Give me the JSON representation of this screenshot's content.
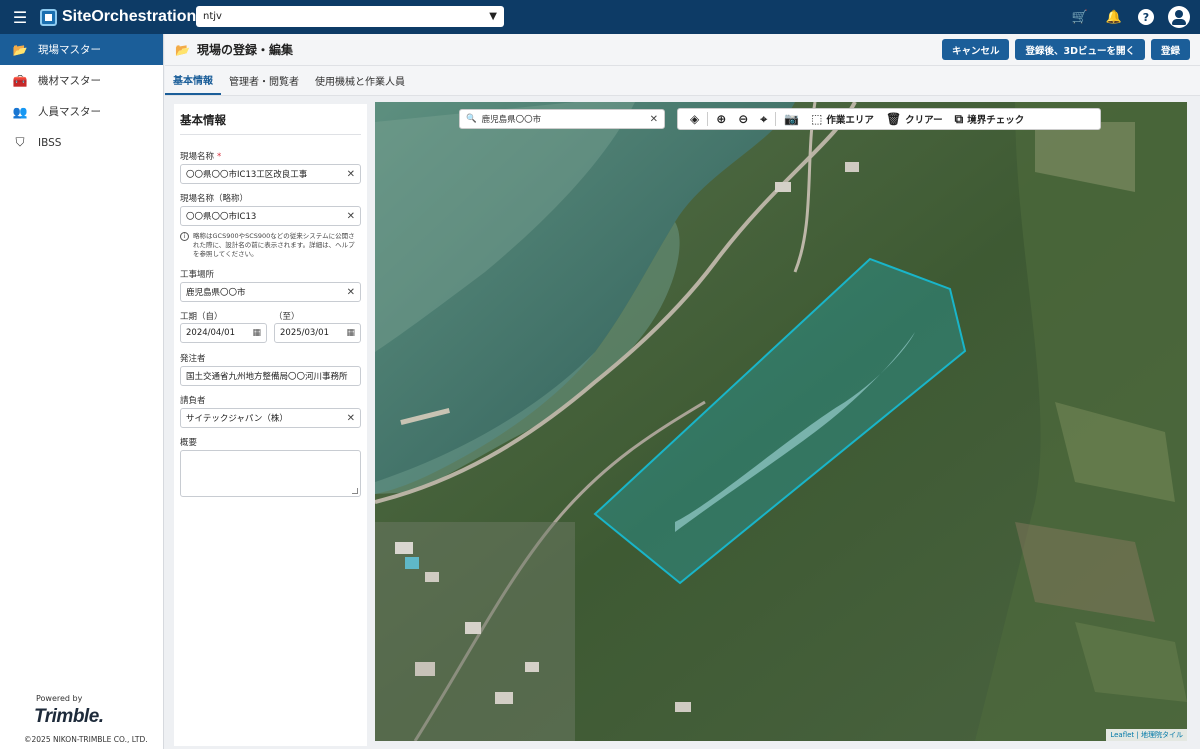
{
  "app": {
    "name": "SiteOrchestration",
    "project_value": "ntjv"
  },
  "sidebar": {
    "items": [
      {
        "label": "現場マスター",
        "icon": "folder-icon",
        "active": true
      },
      {
        "label": "機材マスター",
        "icon": "toolbox-icon",
        "active": false
      },
      {
        "label": "人員マスター",
        "icon": "people-icon",
        "active": false
      },
      {
        "label": "IBSS",
        "icon": "tripod-icon",
        "active": false
      }
    ],
    "powered_by": "Powered by",
    "brand": "Trimble.",
    "copyright": "©2025 NIKON-TRIMBLE CO., LTD."
  },
  "header": {
    "title": "現場の登録・編集",
    "cancel_label": "キャンセル",
    "register_3d_label": "登録後、3Dビューを開く",
    "register_label": "登録"
  },
  "tabs": [
    "基本情報",
    "管理者・閲覧者",
    "使用機械と作業人員"
  ],
  "form": {
    "title": "基本情報",
    "site_name_label": "現場名称",
    "site_name_value": "〇〇県〇〇市IC13工区改良工事",
    "short_name_label": "現場名称（略称）",
    "short_name_value": "〇〇県〇〇市IC13",
    "short_name_hint": "略称はGCS900やSCS900などの従来システムに公開された際に、設計名の前に表示されます。詳細は、ヘルプを参照してください。",
    "location_label": "工事場所",
    "location_value": "鹿児島県〇〇市",
    "period_from_label": "工期（自）",
    "period_from_value": "2024/04/01",
    "period_to_label": "（至）",
    "period_to_value": "2025/03/01",
    "client_label": "発注者",
    "client_value": "国土交通省九州地方整備局〇〇河川事務所",
    "contractor_label": "請負者",
    "contractor_value": "サイテックジャパン（株）",
    "summary_label": "概要",
    "summary_value": ""
  },
  "map": {
    "search_value": "鹿児島県〇〇市",
    "tools": {
      "work_area": "作業エリア",
      "clear": "クリアー",
      "boundary_check": "境界チェック"
    },
    "attribution_leaflet": "Leaflet",
    "attribution_tile": "地理院タイル",
    "area_color": "#19b5c9"
  }
}
